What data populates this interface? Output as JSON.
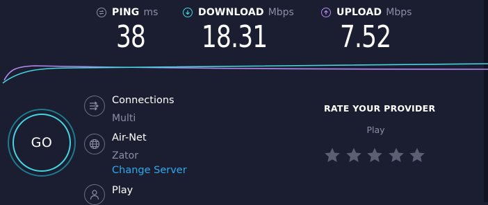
{
  "metrics": {
    "ping": {
      "label": "PING",
      "unit": "ms",
      "value": "38",
      "icon": "ping-icon",
      "color": "#8c8fa8"
    },
    "download": {
      "label": "DOWNLOAD",
      "unit": "Mbps",
      "value": "18.31",
      "icon": "download-arrow-icon",
      "color": "#45d6e0"
    },
    "upload": {
      "label": "UPLOAD",
      "unit": "Mbps",
      "value": "7.52",
      "icon": "upload-arrow-icon",
      "color": "#b38cf2"
    }
  },
  "go_button": {
    "label": "GO"
  },
  "connections": {
    "title": "Connections",
    "value": "Multi",
    "icon": "connections-icon"
  },
  "server": {
    "title": "Air-Net",
    "location": "Zator",
    "change_label": "Change Server",
    "icon": "globe-icon"
  },
  "provider": {
    "name": "Play",
    "icon": "user-icon"
  },
  "rate": {
    "title": "RATE YOUR PROVIDER",
    "provider": "Play",
    "stars": 5,
    "rating": 0
  },
  "colors": {
    "background": "#1b1d31",
    "download_line": "#45d6e0",
    "upload_line": "#b38cf2",
    "link": "#2fa9ea"
  }
}
